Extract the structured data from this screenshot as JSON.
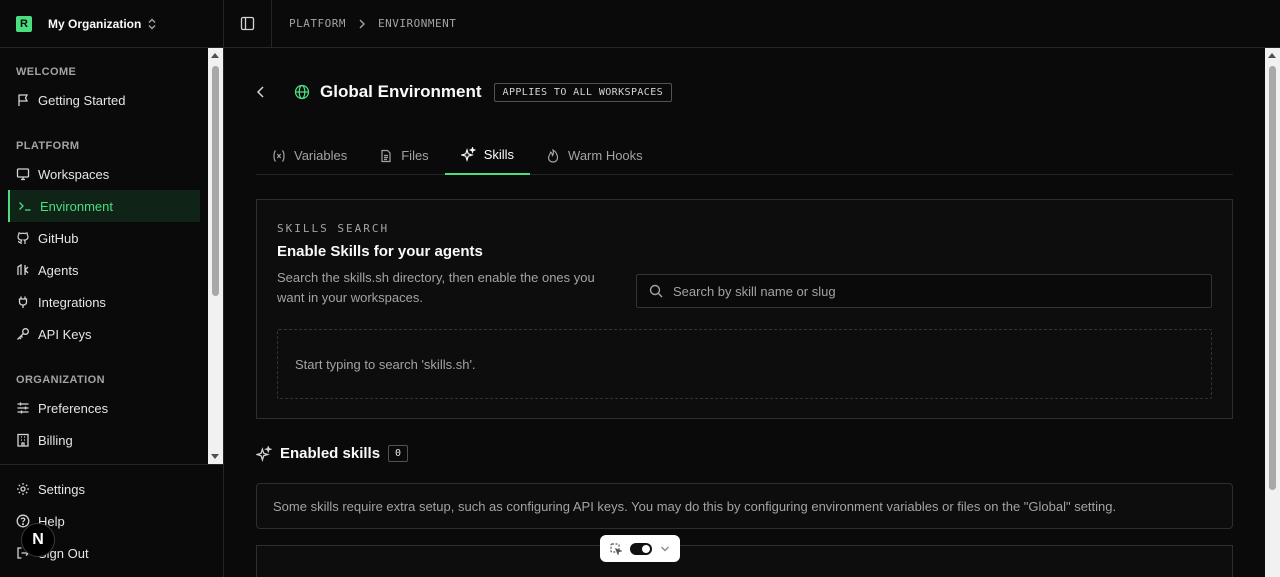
{
  "org": {
    "logo_letter": "R",
    "name": "My Organization"
  },
  "nav": {
    "sections": [
      {
        "title": "WELCOME",
        "items": [
          {
            "label": "Getting Started",
            "icon": "flag-icon"
          }
        ]
      },
      {
        "title": "PLATFORM",
        "items": [
          {
            "label": "Workspaces",
            "icon": "monitor-icon"
          },
          {
            "label": "Environment",
            "icon": "terminal-icon",
            "active": true
          },
          {
            "label": "GitHub",
            "icon": "github-icon"
          },
          {
            "label": "Agents",
            "icon": "agents-icon"
          },
          {
            "label": "Integrations",
            "icon": "plug-icon"
          },
          {
            "label": "API Keys",
            "icon": "key-icon"
          }
        ]
      },
      {
        "title": "ORGANIZATION",
        "items": [
          {
            "label": "Preferences",
            "icon": "sliders-icon"
          },
          {
            "label": "Billing",
            "icon": "building-icon"
          }
        ]
      }
    ],
    "bottom": [
      {
        "label": "Settings",
        "icon": "gear-icon"
      },
      {
        "label": "Help",
        "icon": "help-icon"
      },
      {
        "label": "Sign Out",
        "icon": "sign-out-icon"
      }
    ]
  },
  "breadcrumb": [
    "PLATFORM",
    "ENVIRONMENT"
  ],
  "page": {
    "title": "Global Environment",
    "badge": "APPLIES TO ALL WORKSPACES"
  },
  "tabs": [
    {
      "label": "Variables",
      "icon": "variable-icon"
    },
    {
      "label": "Files",
      "icon": "file-icon"
    },
    {
      "label": "Skills",
      "icon": "sparkles-icon",
      "active": true
    },
    {
      "label": "Warm Hooks",
      "icon": "flame-icon"
    }
  ],
  "skills_search": {
    "kicker": "SKILLS SEARCH",
    "title": "Enable Skills for your agents",
    "description": "Search the skills.sh directory, then enable the ones you want in your workspaces.",
    "placeholder": "Search by skill name or slug",
    "empty_text": "Start typing to search 'skills.sh'."
  },
  "enabled": {
    "title": "Enabled skills",
    "count": "0",
    "note": "Some skills require extra setup, such as configuring API keys. You may do this by configuring environment variables or files on the \"Global\" setting."
  },
  "nextjs_badge": "N",
  "colors": {
    "accent": "#4ade80",
    "background": "#0a0a0a",
    "border": "#262626"
  }
}
